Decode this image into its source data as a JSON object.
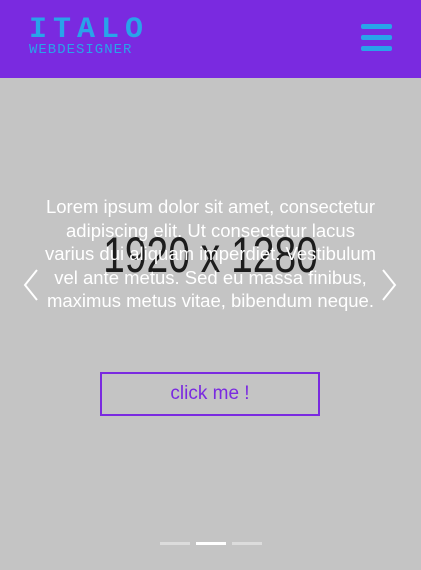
{
  "brand": {
    "title": "ITALO",
    "subtitle": "WEBDESIGNER"
  },
  "menu": {
    "icon": "hamburger-menu-icon"
  },
  "slider": {
    "image_text": "1920 x 1280",
    "caption": "Lorem ipsum dolor sit amet, consectetur adipiscing elit. Ut consectetur lacus varius dui aliquam imperdiet. Vestibulum vel ante metus. Sed eu massa finibus, maximus metus vitae, bibendum neque.",
    "button_label": "click me !",
    "prev_icon": "chevron-left-icon",
    "next_icon": "chevron-right-icon",
    "slide_count": 3,
    "active_slide": 2
  },
  "colors": {
    "header_bg": "#7a2ae0",
    "logo": "#29a3ea",
    "slide_bg": "#c4c4c4",
    "accent": "#7a2ae0"
  }
}
